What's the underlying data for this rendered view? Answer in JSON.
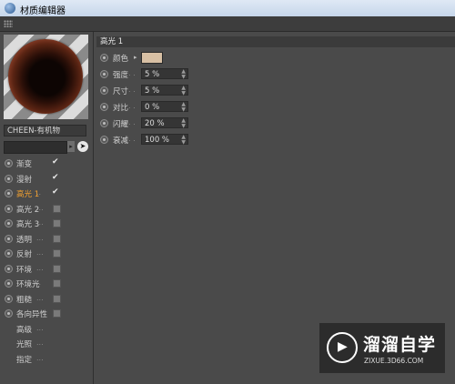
{
  "window": {
    "title": "材质编辑器"
  },
  "material": {
    "name": "CHEEN-有机物"
  },
  "channels": [
    {
      "label": "渐变",
      "dots": "",
      "state": "check"
    },
    {
      "label": "漫射",
      "dots": "",
      "state": "check"
    },
    {
      "label": "高光 1",
      "dots": "..",
      "state": "check",
      "active": true
    },
    {
      "label": "高光 2",
      "dots": "...",
      "state": "box"
    },
    {
      "label": "高光 3",
      "dots": "...",
      "state": "box"
    },
    {
      "label": "透明",
      "dots": "...",
      "state": "box"
    },
    {
      "label": "反射",
      "dots": "...",
      "state": "box"
    },
    {
      "label": "环境",
      "dots": "...",
      "state": "box"
    },
    {
      "label": "环境光",
      "dots": "..",
      "state": "box"
    },
    {
      "label": "粗糙",
      "dots": "...",
      "state": "box"
    },
    {
      "label": "各向异性",
      "dots": "",
      "state": "box"
    },
    {
      "label": "高级",
      "dots": "...",
      "state": "none",
      "noradio": true
    },
    {
      "label": "光照",
      "dots": "...",
      "state": "none",
      "noradio": true
    },
    {
      "label": "指定",
      "dots": "...",
      "state": "none",
      "noradio": true
    }
  ],
  "section": {
    "title": "高光 1"
  },
  "props": [
    {
      "label": "颜色",
      "type": "color",
      "color": "#d8c0a4"
    },
    {
      "label": "强度",
      "type": "number",
      "value": "5 %"
    },
    {
      "label": "尺寸",
      "type": "number",
      "value": "5 %"
    },
    {
      "label": "对比",
      "type": "number",
      "value": "0 %"
    },
    {
      "label": "闪耀",
      "type": "number",
      "value": "20 %"
    },
    {
      "label": "衰减",
      "type": "number",
      "value": "100 %"
    }
  ],
  "watermark": {
    "name": "溜溜自学",
    "url": "ZIXUE.3D66.COM"
  }
}
